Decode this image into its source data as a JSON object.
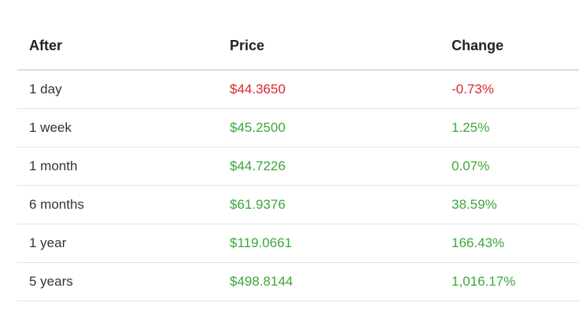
{
  "table": {
    "headers": [
      "After",
      "Price",
      "Change"
    ],
    "rows": [
      {
        "period": "1 day",
        "price": "$44.3650",
        "change": "-0.73%",
        "trend": "down"
      },
      {
        "period": "1 week",
        "price": "$45.2500",
        "change": "1.25%",
        "trend": "up"
      },
      {
        "period": "1 month",
        "price": "$44.7226",
        "change": "0.07%",
        "trend": "up"
      },
      {
        "period": "6 months",
        "price": "$61.9376",
        "change": "38.59%",
        "trend": "up"
      },
      {
        "period": "1 year",
        "price": "$119.0661",
        "change": "166.43%",
        "trend": "up"
      },
      {
        "period": "5 years",
        "price": "$498.8144",
        "change": "1,016.17%",
        "trend": "up"
      }
    ]
  },
  "colors": {
    "negative": "#d9262c",
    "positive": "#3aa73a"
  }
}
